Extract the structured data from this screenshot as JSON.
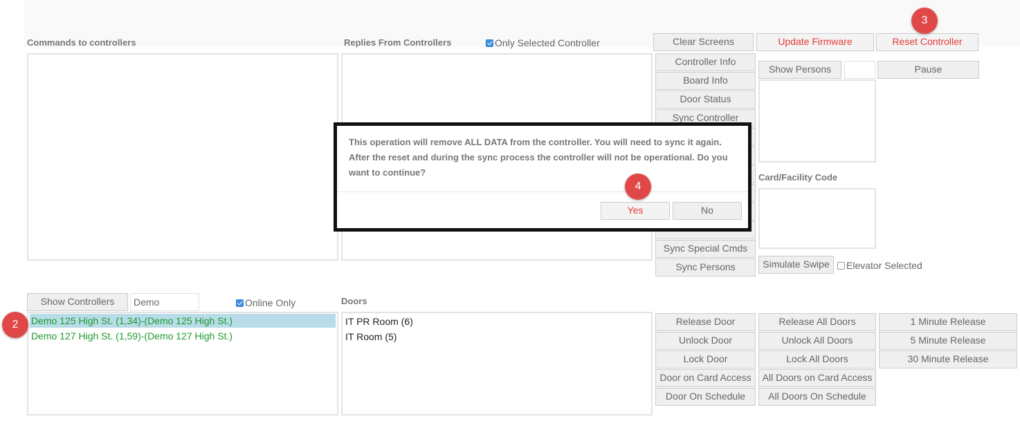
{
  "commands_heading": "Commands to controllers",
  "replies": {
    "heading": "Replies From Controllers",
    "only_selected_label": "Only Selected Controller"
  },
  "top_buttons": {
    "clear_screens": "Clear Screens",
    "update_firmware": "Update Firmware",
    "reset_controller": "Reset Controller"
  },
  "command_buttons": [
    "Controller Info",
    "Board Info",
    "Door Status",
    "Sync Controller",
    "Sync Special Cmds",
    "Sync Persons"
  ],
  "persons": {
    "show_button": "Show Persons",
    "input_value": "",
    "pause_button": "Pause"
  },
  "card_facility": {
    "heading": "Card/Facility Code",
    "simulate_button": "Simulate Swipe",
    "elevator_label": "Elevator Selected"
  },
  "controllers": {
    "show_button": "Show Controllers",
    "filter_value": "Demo",
    "online_only_label": "Online Only",
    "items": [
      "Demo 125 High St. (1,34)-(Demo 125 High St.)",
      "Demo 127 High St. (1,59)-(Demo 127 High St.)"
    ]
  },
  "doors": {
    "heading": "Doors",
    "items": [
      "IT PR Room (6)",
      "IT Room (5)"
    ]
  },
  "door_buttons": {
    "single": [
      "Release Door",
      "Unlock Door",
      "Lock Door",
      "Door on Card Access",
      "Door On Schedule"
    ],
    "all": [
      "Release All Doors",
      "Unlock All Doors",
      "Lock All Doors",
      "All Doors on Card Access",
      "All Doors On Schedule"
    ],
    "timed": [
      "1 Minute Release",
      "5 Minute Release",
      "30 Minute Release"
    ]
  },
  "dialog": {
    "message": "This operation will remove ALL DATA from the controller. You will need to sync it again. After the reset and during the sync process the controller will not be operational. Do you want to continue?",
    "yes": "Yes",
    "no": "No"
  },
  "callouts": [
    "2",
    "3",
    "4"
  ],
  "colors": {
    "accent_red": "#e53935",
    "callout_red": "#e04848",
    "online_green": "#1e9a2e",
    "selection_blue": "#b8dce8",
    "checkbox_blue": "#3d8fe0"
  }
}
